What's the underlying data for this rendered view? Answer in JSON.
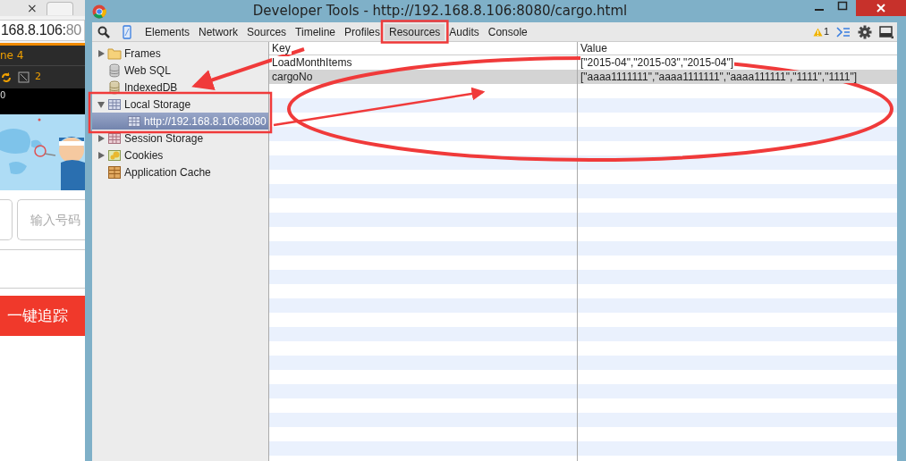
{
  "background_page": {
    "tab_close": "×",
    "address": "168.8.106:80",
    "toolbar_title": "ne 4",
    "toolbar_count": "2",
    "ruler_label": "0",
    "number_field": {
      "placeholder": "输入号码"
    },
    "track_button": "一键追踪"
  },
  "window": {
    "title": "Developer Tools - http://192.168.8.106:8080/cargo.html"
  },
  "tabs": [
    {
      "label": "Elements",
      "selected": false
    },
    {
      "label": "Network",
      "selected": false
    },
    {
      "label": "Sources",
      "selected": false
    },
    {
      "label": "Timeline",
      "selected": false
    },
    {
      "label": "Profiles",
      "selected": false
    },
    {
      "label": "Resources",
      "selected": true
    },
    {
      "label": "Audits",
      "selected": false
    },
    {
      "label": "Console",
      "selected": false
    }
  ],
  "warning_count": "1",
  "sidebar": {
    "items": [
      {
        "label": "Frames",
        "kind": "folder",
        "expanded": false,
        "selected": false
      },
      {
        "label": "Web SQL",
        "kind": "websql",
        "selected": false
      },
      {
        "label": "IndexedDB",
        "kind": "indexeddb",
        "selected": false
      },
      {
        "label": "Local Storage",
        "kind": "localstorage",
        "expanded": true,
        "selected": false,
        "children": [
          {
            "label": "http://192.168.8.106:8080",
            "kind": "localstorage",
            "selected": true
          }
        ]
      },
      {
        "label": "Session Storage",
        "kind": "sessionstorage",
        "expanded": false,
        "selected": false
      },
      {
        "label": "Cookies",
        "kind": "cookies",
        "expanded": false,
        "selected": false
      },
      {
        "label": "Application Cache",
        "kind": "appcache",
        "selected": false
      }
    ]
  },
  "table": {
    "columns": [
      "Key",
      "Value"
    ],
    "rows": [
      {
        "cells": [
          "LoadMonthItems",
          "[\"2015-04\",\"2015-03\",\"2015-04\"]"
        ],
        "selected": false
      },
      {
        "cells": [
          "cargoNo",
          "[\"aaaa1111111\",\"aaaa1111111\",\"aaaa111111\",\"1111\",\"1111\"]"
        ],
        "selected": true
      }
    ]
  }
}
